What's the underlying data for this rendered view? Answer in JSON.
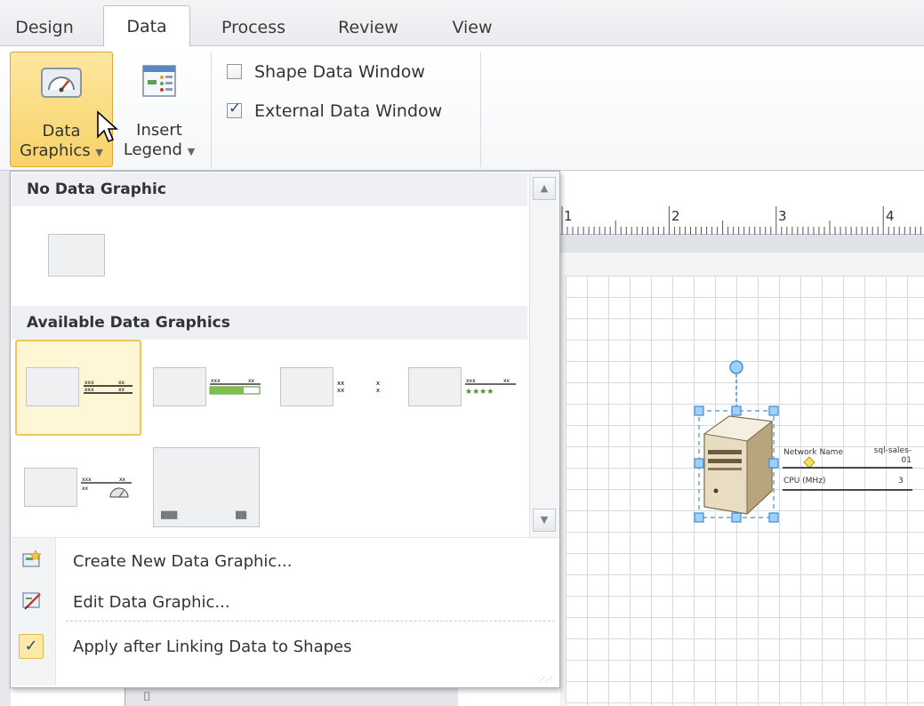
{
  "tabs": [
    {
      "label": "Design"
    },
    {
      "label": "Data",
      "active": true
    },
    {
      "label": "Process"
    },
    {
      "label": "Review"
    },
    {
      "label": "View"
    }
  ],
  "ribbon": {
    "data_graphics": {
      "line1": "Data",
      "line2": "Graphics",
      "icon": "gauge-icon"
    },
    "insert_legend": {
      "line1": "Insert",
      "line2": "Legend",
      "icon": "legend-icon"
    },
    "show_hide": [
      {
        "label": "Shape Data Window",
        "checked": false
      },
      {
        "label": "External Data Window",
        "checked": true
      }
    ]
  },
  "gallery": {
    "sections": [
      {
        "title": "No Data Graphic"
      },
      {
        "title": "Available Data Graphics"
      }
    ],
    "menu": [
      {
        "label": "Create New Data Graphic...",
        "icon": "new-data-graphic-icon"
      },
      {
        "label": "Edit Data Graphic...",
        "icon": "edit-data-graphic-icon"
      },
      {
        "label": "Apply after Linking Data to Shapes",
        "icon": "checkmark-icon",
        "checked": true
      }
    ]
  },
  "ruler": {
    "marks": [
      "1",
      "2",
      "3",
      "4"
    ]
  },
  "shape": {
    "callout": [
      {
        "label": "Network Name",
        "value": "sql-sales-01"
      },
      {
        "label": "CPU (MHz)",
        "value": "3"
      }
    ]
  },
  "colors": {
    "accent_gold": "#f9d268",
    "selection_blue": "#4a90d9",
    "grid_line": "#d7dade"
  }
}
